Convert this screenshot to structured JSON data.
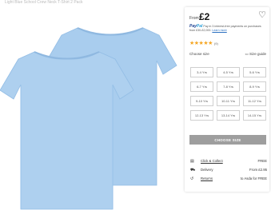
{
  "breadcrumb": "Light Blue School Crew Neck T-Shirt 2 Pack",
  "price": {
    "prefix": "From",
    "amount": "£2"
  },
  "paypal": {
    "logo_a": "Pay",
    "logo_b": "Pal",
    "text": "Pay in 3 interest-free payments on purchases from £30-£2,000.",
    "learn_more": "Learn more"
  },
  "rating": {
    "stars": "★★★★★",
    "count": "(9)",
    "value": 5
  },
  "sizes": {
    "label": "Choose size",
    "guide_label": "Size guide",
    "options": [
      "3-4 Yrs",
      "4-5 Yrs",
      "5-6 Yrs",
      "6-7 Yrs",
      "7-8 Yrs",
      "8-9 Yrs",
      "9-10 Yrs",
      "10-11 Yrs",
      "11-12 Yrs",
      "12-13 Yrs",
      "13-14 Yrs",
      "14-15 Yrs"
    ]
  },
  "choose_button": "CHOOSE SIZE",
  "delivery": [
    {
      "icon": "store-icon",
      "label": "Click & Collect",
      "value": "FREE"
    },
    {
      "icon": "truck-icon",
      "label": "Delivery",
      "value": "From £2.95"
    },
    {
      "icon": "return-icon",
      "label": "Returns",
      "value": "to Asda for FREE"
    }
  ],
  "colors": {
    "shirt": "#a9cdee",
    "shirt_shade": "#8fb8e0",
    "star": "#f5a623",
    "button": "#9e9e9e"
  }
}
